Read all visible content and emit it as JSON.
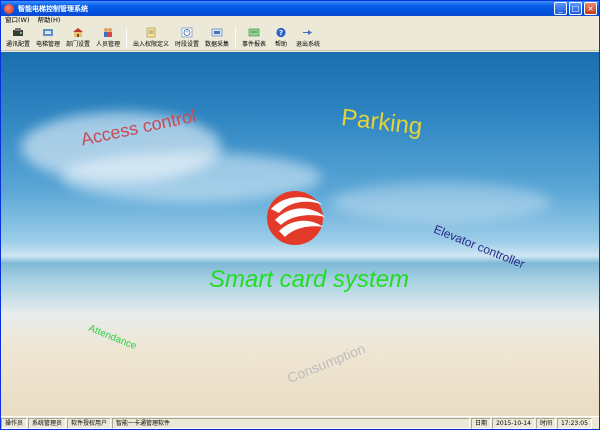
{
  "window": {
    "title": "智能电梯控制管理系统",
    "minimize": "_",
    "maximize": "□",
    "close": "×"
  },
  "menu": {
    "items": [
      {
        "label": "窗口(W)"
      },
      {
        "label": "帮助(H)"
      }
    ]
  },
  "toolbar": {
    "items": [
      {
        "label": "通讯配置",
        "icon": "communication-icon"
      },
      {
        "label": "电梯管理",
        "icon": "elevator-icon"
      },
      {
        "label": "部门设置",
        "icon": "department-icon"
      },
      {
        "label": "人员管理",
        "icon": "people-icon"
      },
      {
        "label": "出入权限定义",
        "icon": "access-permission-icon"
      },
      {
        "label": "时段设置",
        "icon": "time-period-icon"
      },
      {
        "label": "数据采集",
        "icon": "data-collection-icon"
      },
      {
        "label": "事件报表",
        "icon": "event-report-icon"
      },
      {
        "label": "帮助",
        "icon": "help-icon"
      },
      {
        "label": "退出系统",
        "icon": "exit-icon"
      }
    ]
  },
  "background": {
    "labels": {
      "access_control": "Access control",
      "parking": "Parking",
      "elevator_controller": "Elevator controller",
      "smart_card_system": "Smart card system",
      "attendance": "Attendance",
      "consumption": "Consumption"
    },
    "colors": {
      "access_control": "#c94a55",
      "parking": "#e4d23a",
      "elevator_controller": "#2a2a8a",
      "smart_card_system": "#22dd22",
      "attendance": "#2fcf4a",
      "consumption": "#bdbdbd"
    }
  },
  "status": {
    "operator_label": "操作员",
    "operator_value": "系统管理员",
    "license_label": "软件授权用户",
    "license_value": "智能一卡通管理软件",
    "date_label": "日期",
    "date_value": "2015-10-14",
    "time_label": "时间",
    "time_value": "17:23:05"
  }
}
